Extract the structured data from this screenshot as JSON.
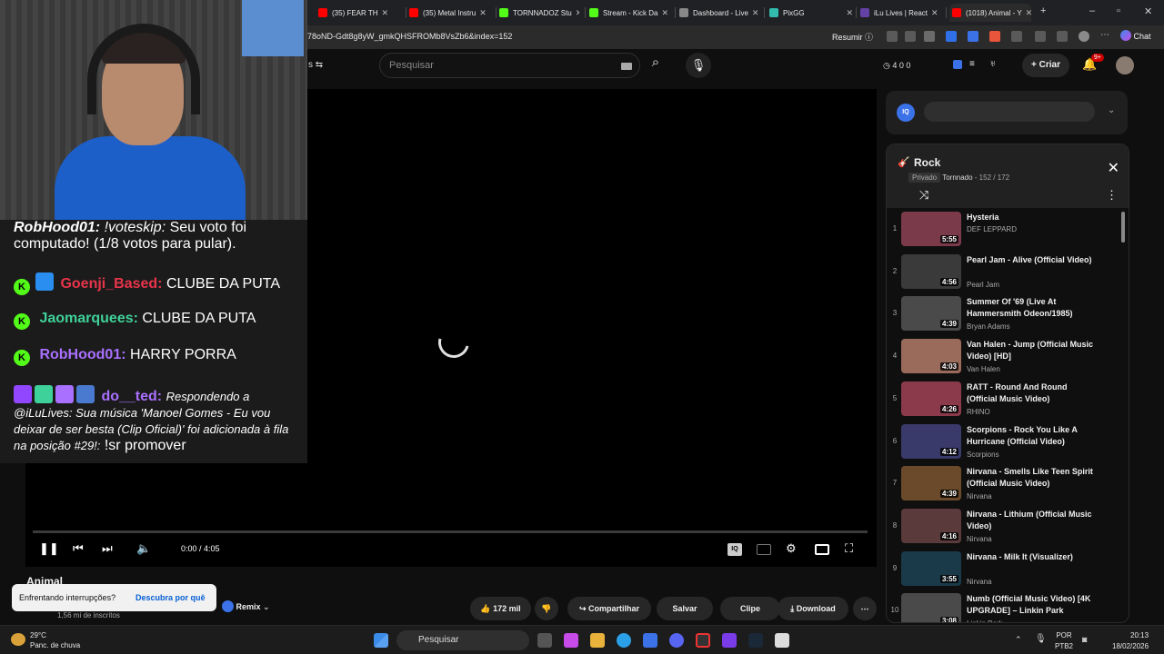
{
  "browser": {
    "tabs": [
      {
        "label": "(35) FEAR TH",
        "color": "#ff0000"
      },
      {
        "label": "(35) Metal Instru",
        "color": "#ff0000"
      },
      {
        "label": "TORNNADOZ Stu",
        "color": "#53fc18"
      },
      {
        "label": "Stream - Kick Da",
        "color": "#53fc18"
      },
      {
        "label": "Dashboard - Live",
        "color": "#888888"
      },
      {
        "label": "PixGG",
        "color": "#32bcad"
      },
      {
        "label": "iLu Lives | React",
        "color": "#6441a5"
      },
      {
        "label": "(1018) Animal - Y",
        "color": "#ff0000"
      }
    ],
    "url": "78oND-Gdt8g8yW_gmkQHSFROMb8VsZb6&index=152",
    "resume_label": "Resumir",
    "chat_label": "Chat"
  },
  "header": {
    "search_placeholder": "Pesquisar",
    "stats": "4  0  0",
    "create_label": "Criar",
    "notif_count": "9+"
  },
  "player": {
    "time": "0:00 / 4:05",
    "progress": 0.0
  },
  "video": {
    "title": "Animal",
    "subscribers": "1,56 mi de inscritos",
    "remix_label": "Remix",
    "likes": "172 mil",
    "share_label": "Compartilhar",
    "save_label": "Salvar",
    "clip_label": "Clipe",
    "download_label": "Download"
  },
  "toast": {
    "message": "Enfrentando interrupções?",
    "link": "Descubra por quê"
  },
  "chat": {
    "messages": [
      {
        "user": "RobHood01:",
        "text": "!voteskip:",
        "rest": "Seu voto foi computado! (1/8 votos para pular)."
      },
      {
        "user": "Goenji_Based:",
        "text": "CLUBE DA PUTA",
        "color": "#e8344a"
      },
      {
        "user": "Jaomarquees:",
        "text": "CLUBE DA PUTA",
        "color": "#3fd19a"
      },
      {
        "user": "RobHood01:",
        "text": "HARRY PORRA",
        "color": "#a970ff"
      },
      {
        "user": "do__ted:",
        "text": "Respondendo a @iLuLives: Sua música 'Manoel Gomes - Eu vou deixar de ser besta (Clip Oficial)' foi adicionada à fila na posição #29!:",
        "rest": "!sr promover",
        "color": "#a970ff"
      }
    ]
  },
  "playlist": {
    "title": "Rock",
    "privacy": "Privado",
    "owner": "Tornnado",
    "position": "152 / 172",
    "items": [
      {
        "num": "1",
        "title": "Hysteria",
        "artist": "DEF LEPPARD",
        "duration": "5:55",
        "color": "#7a3a4a"
      },
      {
        "num": "2",
        "title": "Pearl Jam - Alive (Official Video)",
        "artist": "Pearl Jam",
        "duration": "4:56",
        "color": "#3a3a3a"
      },
      {
        "num": "3",
        "title": "Summer Of '69 (Live At Hammersmith Odeon/1985)",
        "artist": "Bryan Adams",
        "duration": "4:39",
        "color": "#4a4a4a"
      },
      {
        "num": "4",
        "title": "Van Halen - Jump (Official Music Video) [HD]",
        "artist": "Van Halen",
        "duration": "4:03",
        "color": "#9a6a5a"
      },
      {
        "num": "5",
        "title": "RATT - Round And Round (Official Music Video)",
        "artist": "RHINO",
        "duration": "4:26",
        "color": "#8a3a4a"
      },
      {
        "num": "6",
        "title": "Scorpions - Rock You Like A Hurricane (Official Video)",
        "artist": "Scorpions",
        "duration": "4:12",
        "color": "#3a3a6a"
      },
      {
        "num": "7",
        "title": "Nirvana - Smells Like Teen Spirit (Official Music Video)",
        "artist": "Nirvana",
        "duration": "4:39",
        "color": "#6a4a2a"
      },
      {
        "num": "8",
        "title": "Nirvana - Lithium (Official Music Video)",
        "artist": "Nirvana",
        "duration": "4:16",
        "color": "#5a3a3a"
      },
      {
        "num": "9",
        "title": "Nirvana - Milk It (Visualizer)",
        "artist": "Nirvana",
        "duration": "3:55",
        "color": "#1a3a4a"
      },
      {
        "num": "10",
        "title": "Numb (Official Music Video) [4K UPGRADE] – Linkin Park",
        "artist": "Linkin Park",
        "duration": "3:08",
        "color": "#4a4a4a"
      }
    ]
  },
  "taskbar": {
    "temp": "29°C",
    "weather": "Panc. de chuva",
    "search": "Pesquisar",
    "lang1": "POR",
    "lang2": "PTB2",
    "time": "20:13",
    "date": "18/02/2026"
  }
}
